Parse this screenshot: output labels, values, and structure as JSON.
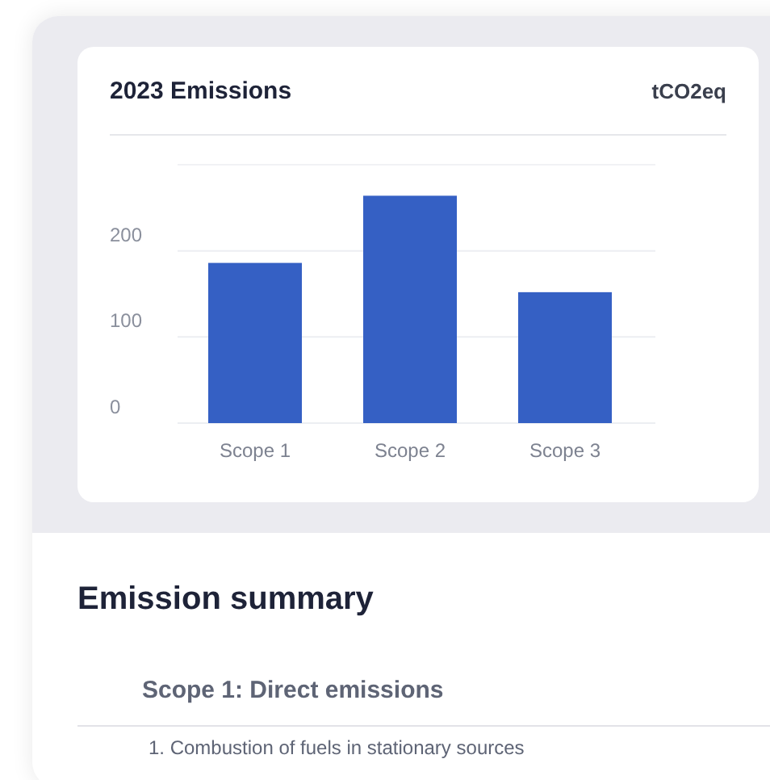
{
  "chart_card": {
    "title": "2023 Emissions",
    "unit": "tCO2eq",
    "chart_data": {
      "type": "bar",
      "categories": [
        "Scope 1",
        "Scope 2",
        "Scope 3"
      ],
      "series": [
        {
          "color": "#3560c4",
          "values": [
            186,
            264,
            152
          ]
        }
      ],
      "ylim": [
        0,
        300
      ],
      "yticks": [
        0,
        100,
        200
      ]
    }
  },
  "summary": {
    "heading": "Emission summary",
    "section_title": "Scope 1: Direct emissions",
    "items": [
      "1. Combustion of fuels in stationary sources"
    ]
  }
}
